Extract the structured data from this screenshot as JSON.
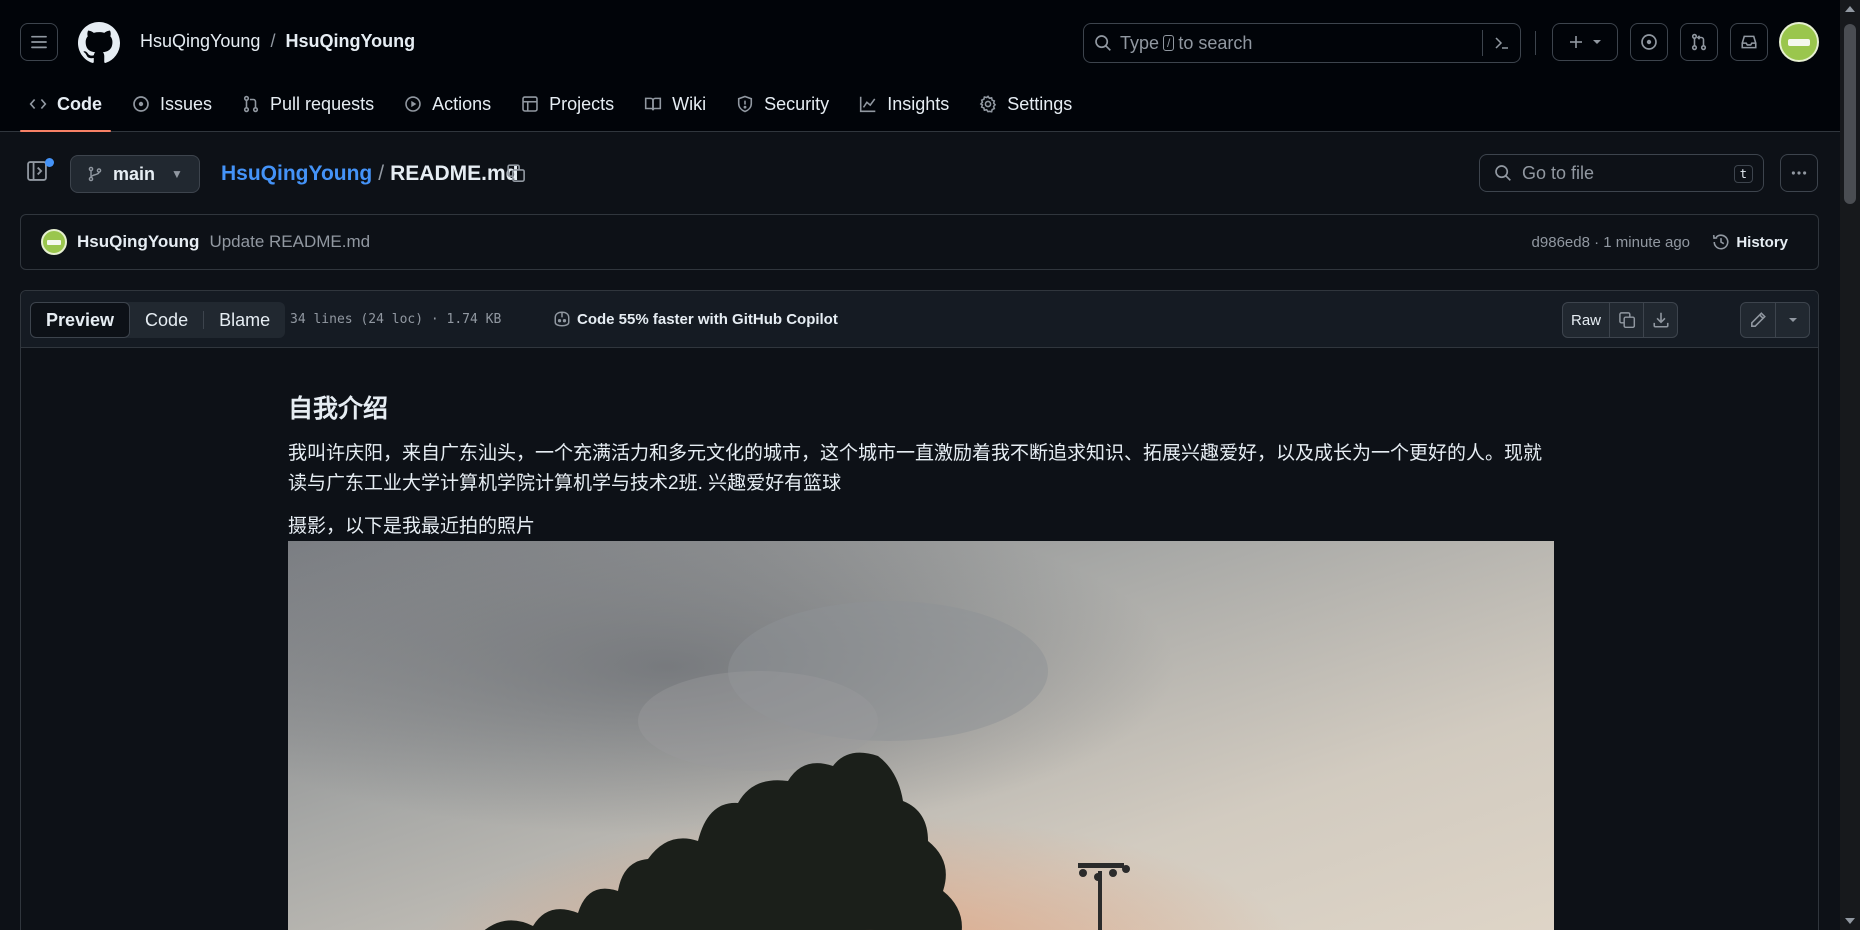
{
  "header": {
    "owner": "HsuQingYoung",
    "separator": "/",
    "repo": "HsuQingYoung",
    "search": {
      "prefix": "Type",
      "key": "/",
      "suffix": "to search"
    }
  },
  "nav": {
    "tabs": [
      {
        "label": "Code",
        "icon": "code-icon",
        "active": true
      },
      {
        "label": "Issues",
        "icon": "issue-icon"
      },
      {
        "label": "Pull requests",
        "icon": "pull-request-icon"
      },
      {
        "label": "Actions",
        "icon": "play-icon"
      },
      {
        "label": "Projects",
        "icon": "table-icon"
      },
      {
        "label": "Wiki",
        "icon": "book-icon"
      },
      {
        "label": "Security",
        "icon": "shield-icon"
      },
      {
        "label": "Insights",
        "icon": "graph-icon"
      },
      {
        "label": "Settings",
        "icon": "gear-icon"
      }
    ]
  },
  "file_nav": {
    "branch": "main",
    "owner": "HsuQingYoung",
    "separator": "/",
    "file": "README.md",
    "goto_placeholder": "Go to file",
    "goto_key": "t"
  },
  "commit": {
    "author": "HsuQingYoung",
    "message": "Update README.md",
    "meta": "d986ed8 · 1 minute ago",
    "history_label": "History"
  },
  "file_header": {
    "tabs": [
      "Preview",
      "Code",
      "Blame"
    ],
    "lines_info": "34 lines (24 loc) · 1.74 KB",
    "copilot": "Code 55% faster with GitHub Copilot",
    "raw_label": "Raw"
  },
  "readme": {
    "heading": "自我介绍",
    "intro": "我叫许庆阳，来自广东汕头，一个充满活力和多元文化的城市，这个城市一直激励着我不断追求知识、拓展兴趣爱好，以及成长为一个更好的人。现就读与广东工业大学计算机学院计算机学与技术2班. 兴趣爱好有篮球",
    "photo_caption": "摄影，以下是我最近拍的照片"
  },
  "colors": {
    "accent": "#4493f8",
    "active_tab_underline": "#f78166",
    "background": "#0d1117",
    "avatar": "#9ac64d"
  }
}
